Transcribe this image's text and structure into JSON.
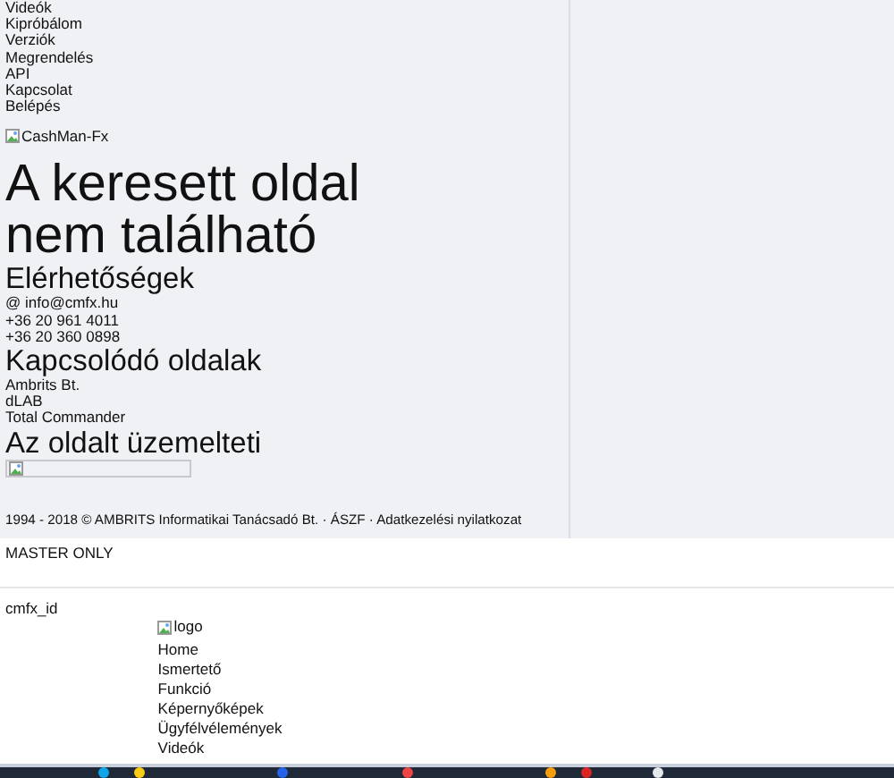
{
  "menu": [
    "Videók",
    "Kipróbálom",
    "Verziók",
    "Megrendelés",
    "API",
    "Kapcsolat",
    "Belépés"
  ],
  "brand_image_alt": "CashMan-Fx",
  "heading": "A keresett oldal nem található",
  "sections": [
    {
      "title": "Elérhetőségek",
      "items": [
        "@ info@cmfx.hu",
        "+36 20 961 4011",
        "+36 20 360 0898"
      ]
    },
    {
      "title": "Kapcsolódó oldalak",
      "items": [
        "Ambrits Bt.",
        "dLAB",
        "Total Commander"
      ]
    },
    {
      "title": "Az oldalt üzemelteti"
    }
  ],
  "footer": "1994 - 2018 © AMBRITS Informatikai Tanácsadó Bt. · ÁSZF · Adatkezelési nyilatkozat",
  "master_label": "MASTER ONLY",
  "field_label": "cmfx_id",
  "preview": {
    "logo_alt": "logo",
    "links": [
      "Home",
      "Ismertető",
      "Funkció",
      "Képernyőképek",
      "Ügyfélvélemények",
      "Videók"
    ]
  }
}
